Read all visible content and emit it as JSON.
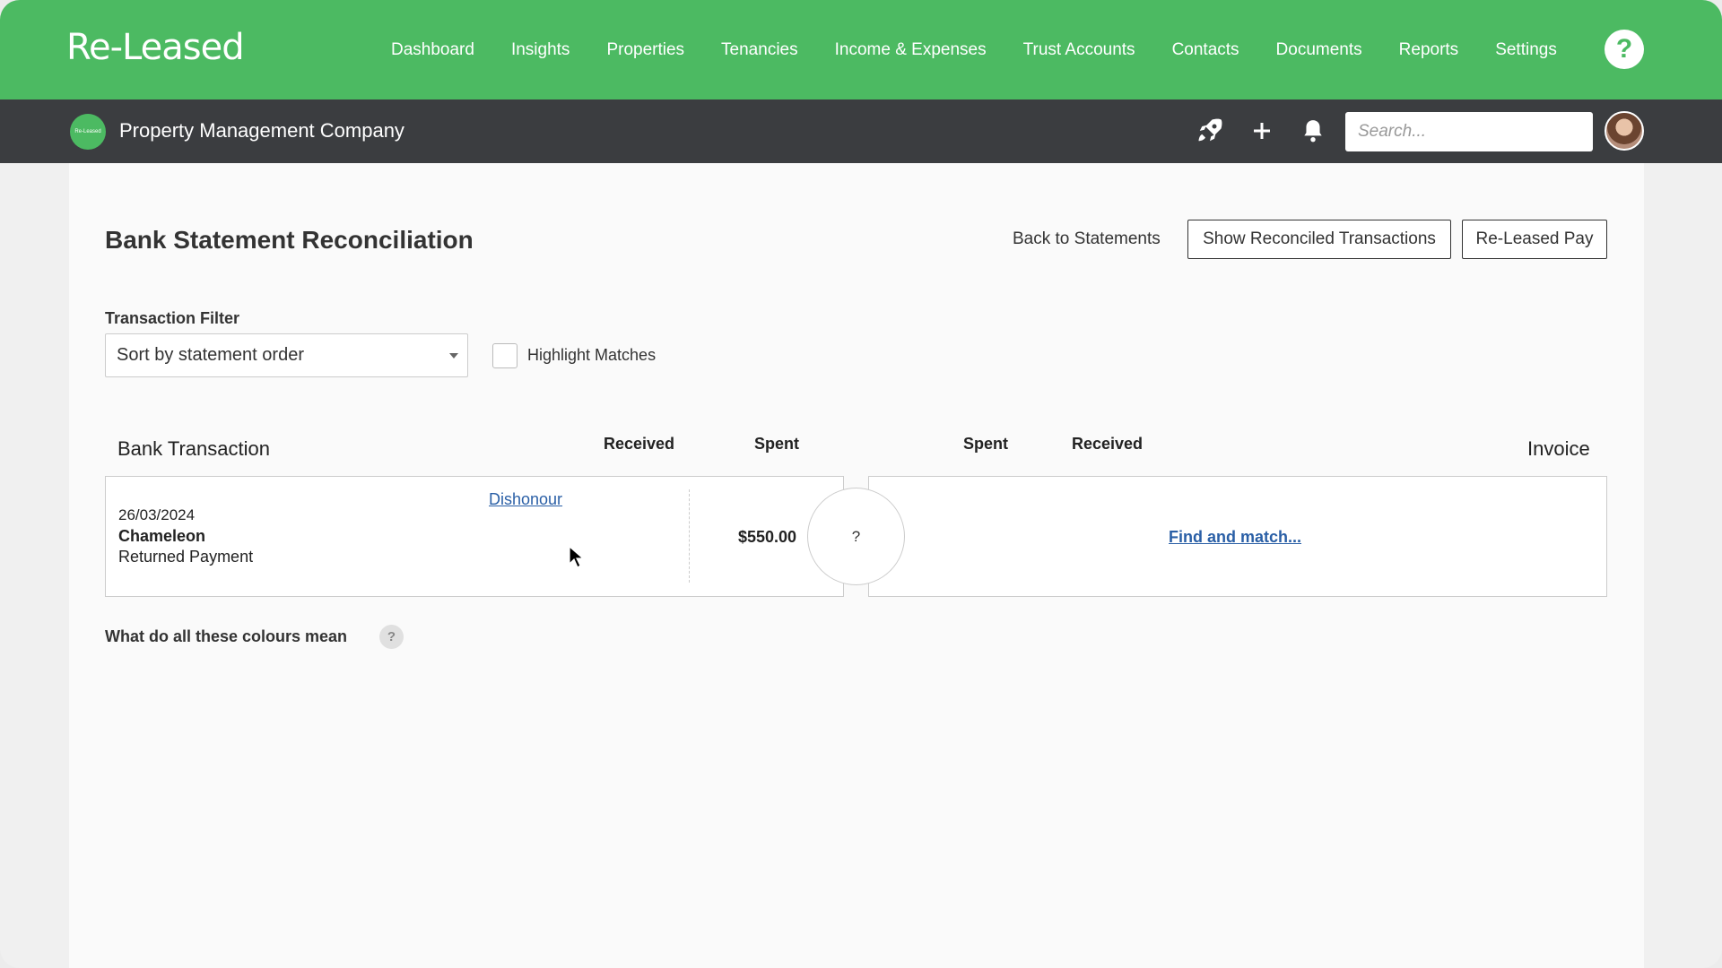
{
  "app": {
    "logo_text": "Re-Leased",
    "nav": [
      {
        "label": "Dashboard"
      },
      {
        "label": "Insights"
      },
      {
        "label": "Properties"
      },
      {
        "label": "Tenancies"
      },
      {
        "label": "Income & Expenses"
      },
      {
        "label": "Trust Accounts"
      },
      {
        "label": "Contacts"
      },
      {
        "label": "Documents"
      },
      {
        "label": "Reports"
      },
      {
        "label": "Settings"
      }
    ],
    "help_symbol": "?"
  },
  "subbar": {
    "company_logo_text": "Re-Leased",
    "company_name": "Property Management Company",
    "icons": [
      "rocket-icon",
      "plus-icon",
      "bell-icon"
    ],
    "search_placeholder": "Search..."
  },
  "page": {
    "title": "Bank Statement Reconciliation",
    "back_link": "Back to Statements",
    "show_reconciled_button": "Show Reconciled Transactions",
    "released_pay_button": "Re-Leased Pay",
    "filter_label": "Transaction Filter",
    "filter_value": "Sort by statement order",
    "highlight_label": "Highlight Matches",
    "highlight_checked": false
  },
  "table": {
    "bank_transaction_header": "Bank Transaction",
    "left_received_header": "Received",
    "left_spent_header": "Spent",
    "right_spent_header": "Spent",
    "right_received_header": "Received",
    "invoice_header": "Invoice",
    "rows": [
      {
        "date": "26/03/2024",
        "name": "Chameleon",
        "description": "Returned Payment",
        "action_link": "Dishonour",
        "received": "",
        "spent": "$550.00",
        "match_symbol": "?",
        "find_match_link": "Find and match..."
      }
    ]
  },
  "footer": {
    "colours_question": "What do all these colours mean",
    "colours_help_symbol": "?"
  },
  "colors": {
    "brand_green": "#4cba62",
    "subbar_dark": "#3b3d40",
    "link_blue": "#2a5fa6"
  }
}
